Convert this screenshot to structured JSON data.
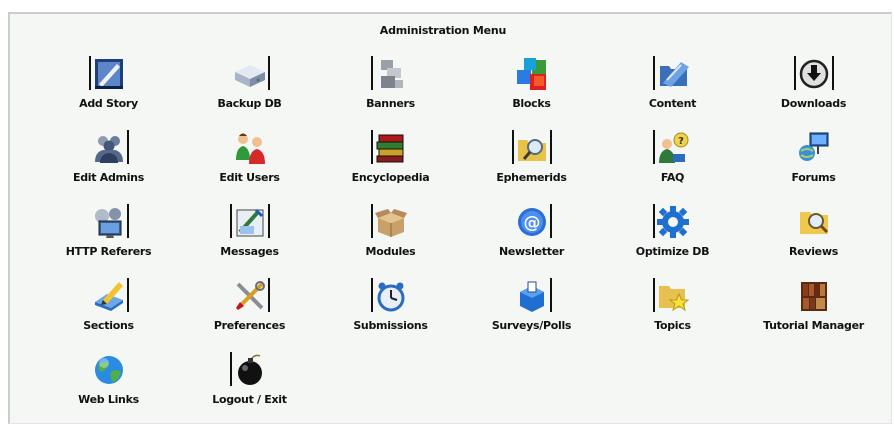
{
  "menu": {
    "title": "Administration Menu",
    "rows": [
      [
        {
          "label": "Add Story",
          "icon": "add-story-icon"
        },
        {
          "label": "Backup DB",
          "icon": "database-drive-icon"
        },
        {
          "label": "Banners",
          "icon": "banners-icon"
        },
        {
          "label": "Blocks",
          "icon": "colored-blocks-icon"
        },
        {
          "label": "Content",
          "icon": "content-folder-icon"
        },
        {
          "label": "Downloads",
          "icon": "download-arrow-icon"
        }
      ],
      [
        {
          "label": "Edit Admins",
          "icon": "admins-group-icon"
        },
        {
          "label": "Edit Users",
          "icon": "users-group-icon"
        },
        {
          "label": "Encyclopedia",
          "icon": "books-stack-icon"
        },
        {
          "label": "Ephemerids",
          "icon": "calendar-search-icon"
        },
        {
          "label": "FAQ",
          "icon": "faq-help-icon"
        },
        {
          "label": "Forums",
          "icon": "forums-network-icon"
        }
      ],
      [
        {
          "label": "HTTP Referers",
          "icon": "referers-computer-icon"
        },
        {
          "label": "Messages",
          "icon": "messages-icon"
        },
        {
          "label": "Modules",
          "icon": "open-box-icon"
        },
        {
          "label": "Newsletter",
          "icon": "at-sign-icon"
        },
        {
          "label": "Optimize DB",
          "icon": "gear-icon"
        },
        {
          "label": "Reviews",
          "icon": "magnifier-icon"
        }
      ],
      [
        {
          "label": "Sections",
          "icon": "pencil-note-icon"
        },
        {
          "label": "Preferences",
          "icon": "tools-icon"
        },
        {
          "label": "Submissions",
          "icon": "clock-icon"
        },
        {
          "label": "Surveys/Polls",
          "icon": "ballot-box-icon"
        },
        {
          "label": "Topics",
          "icon": "star-folder-icon"
        },
        {
          "label": "Tutorial Manager",
          "icon": "bookshelf-icon"
        }
      ],
      [
        {
          "label": "Web Links",
          "icon": "globe-icon"
        },
        {
          "label": "Logout / Exit",
          "icon": "bomb-icon"
        }
      ]
    ]
  }
}
